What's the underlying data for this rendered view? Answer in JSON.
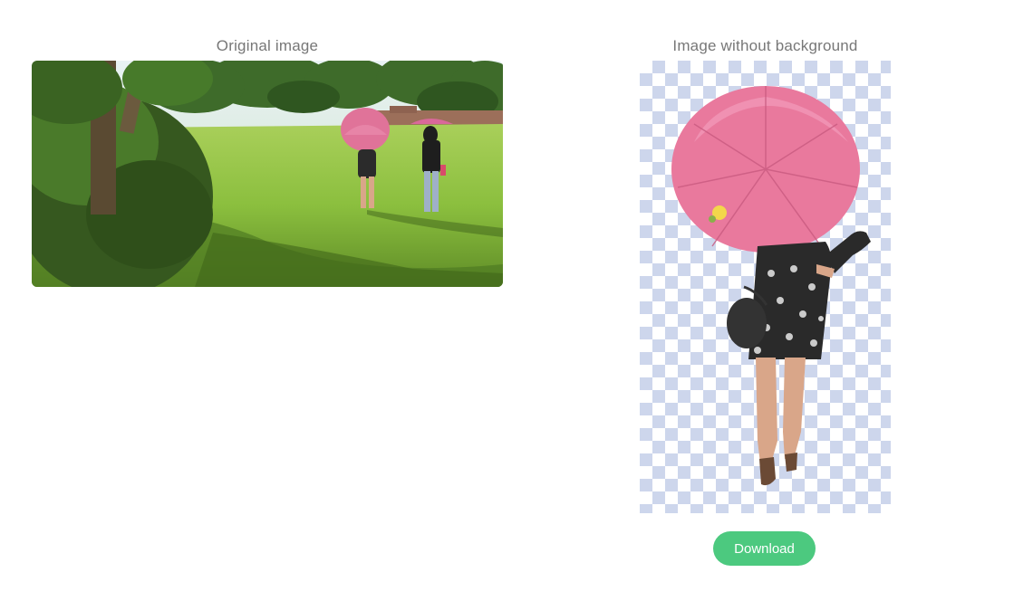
{
  "original": {
    "title": "Original image"
  },
  "result": {
    "title": "Image without background"
  },
  "actions": {
    "download_label": "Download"
  },
  "colors": {
    "accent": "#4cc97f",
    "checker": "#cdd6ec",
    "label_text": "#777777",
    "umbrella": "#e9799d"
  }
}
